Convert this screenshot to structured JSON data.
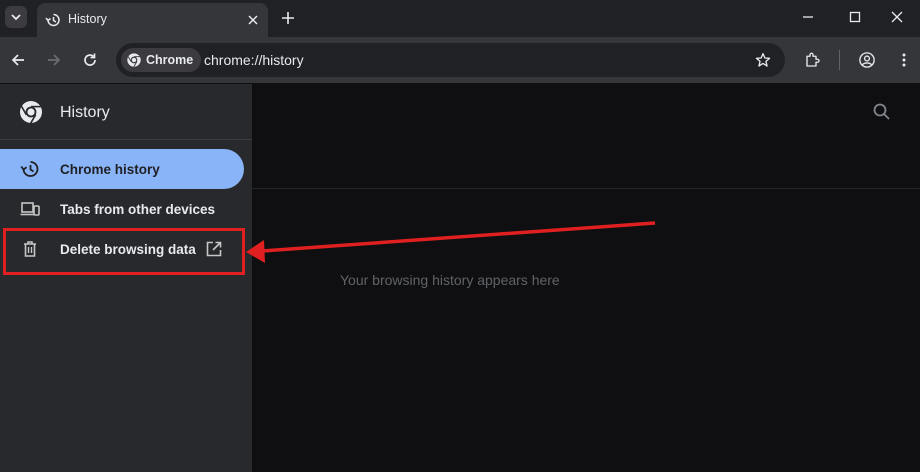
{
  "tabstrip": {
    "tab_title": "History",
    "new_tab_icon": "plus-icon"
  },
  "toolbar": {
    "chip_label": "Chrome",
    "url": "chrome://history"
  },
  "sidebar": {
    "title": "History",
    "items": [
      {
        "label": "Chrome history",
        "icon": "history-icon",
        "selected": true
      },
      {
        "label": "Tabs from other devices",
        "icon": "devices-icon",
        "selected": false
      },
      {
        "label": "Delete browsing data",
        "icon": "trash-icon",
        "selected": false,
        "external": true
      }
    ]
  },
  "main": {
    "empty_message": "Your browsing history appears here"
  },
  "colors": {
    "accent": "#8ab4f8",
    "annotation": "#e02020"
  }
}
